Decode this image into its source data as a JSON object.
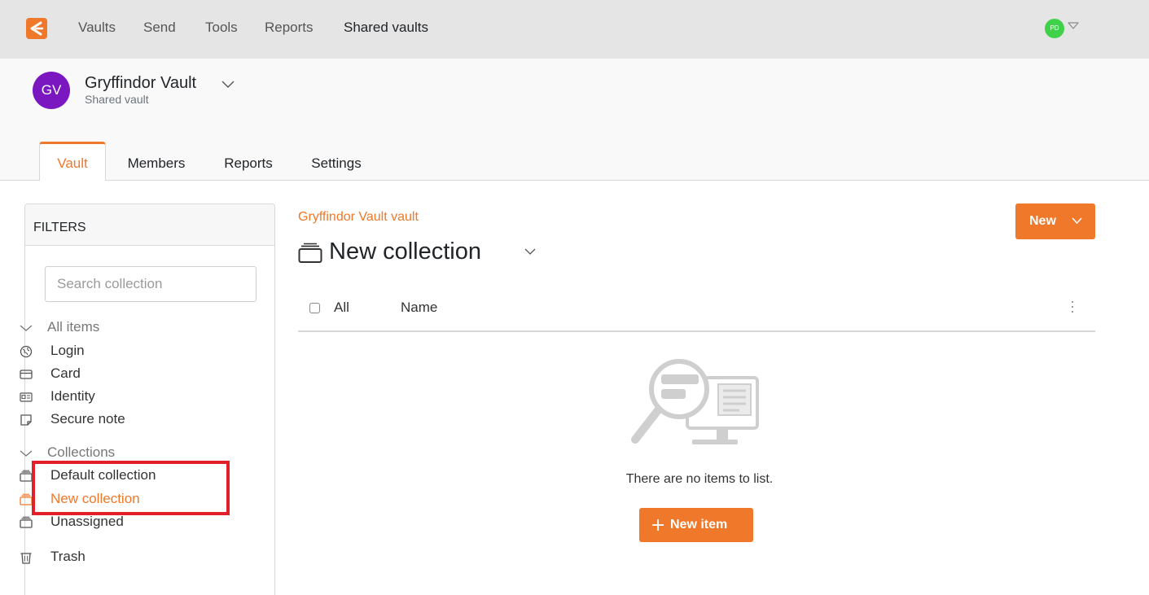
{
  "topnav": {
    "items": [
      "Vaults",
      "Send",
      "Tools",
      "Reports",
      "Shared vaults"
    ],
    "active": "Shared vaults",
    "user_initials": "PD",
    "accent_color": "#f0782a",
    "avatar_color": "#3fd14a"
  },
  "org": {
    "initials": "GV",
    "name": "Gryffindor Vault",
    "subtitle": "Shared vault",
    "avatar_color": "#7a17c1"
  },
  "tabs": [
    "Vault",
    "Members",
    "Reports",
    "Settings"
  ],
  "active_tab": "Vault",
  "filters": {
    "title": "FILTERS",
    "search_placeholder": "Search collection",
    "all_items_label": "All items",
    "types": [
      {
        "label": "Login",
        "icon": "globe-icon"
      },
      {
        "label": "Card",
        "icon": "credit-card-icon"
      },
      {
        "label": "Identity",
        "icon": "id-card-icon"
      },
      {
        "label": "Secure note",
        "icon": "sticky-note-icon"
      }
    ],
    "collections_label": "Collections",
    "collections": [
      {
        "label": "Default collection",
        "icon": "collection-icon",
        "selected": false
      },
      {
        "label": "New collection",
        "icon": "collection-icon",
        "selected": true
      },
      {
        "label": "Unassigned",
        "icon": "collection-icon",
        "selected": false
      }
    ],
    "trash_label": "Trash",
    "highlight_color": "#e3202a"
  },
  "main": {
    "breadcrumb": "Gryffindor Vault vault",
    "title": "New collection",
    "new_button": "New",
    "columns": {
      "all": "All",
      "name": "Name"
    },
    "empty_text": "There are no items to list.",
    "new_item_button": "New item"
  }
}
